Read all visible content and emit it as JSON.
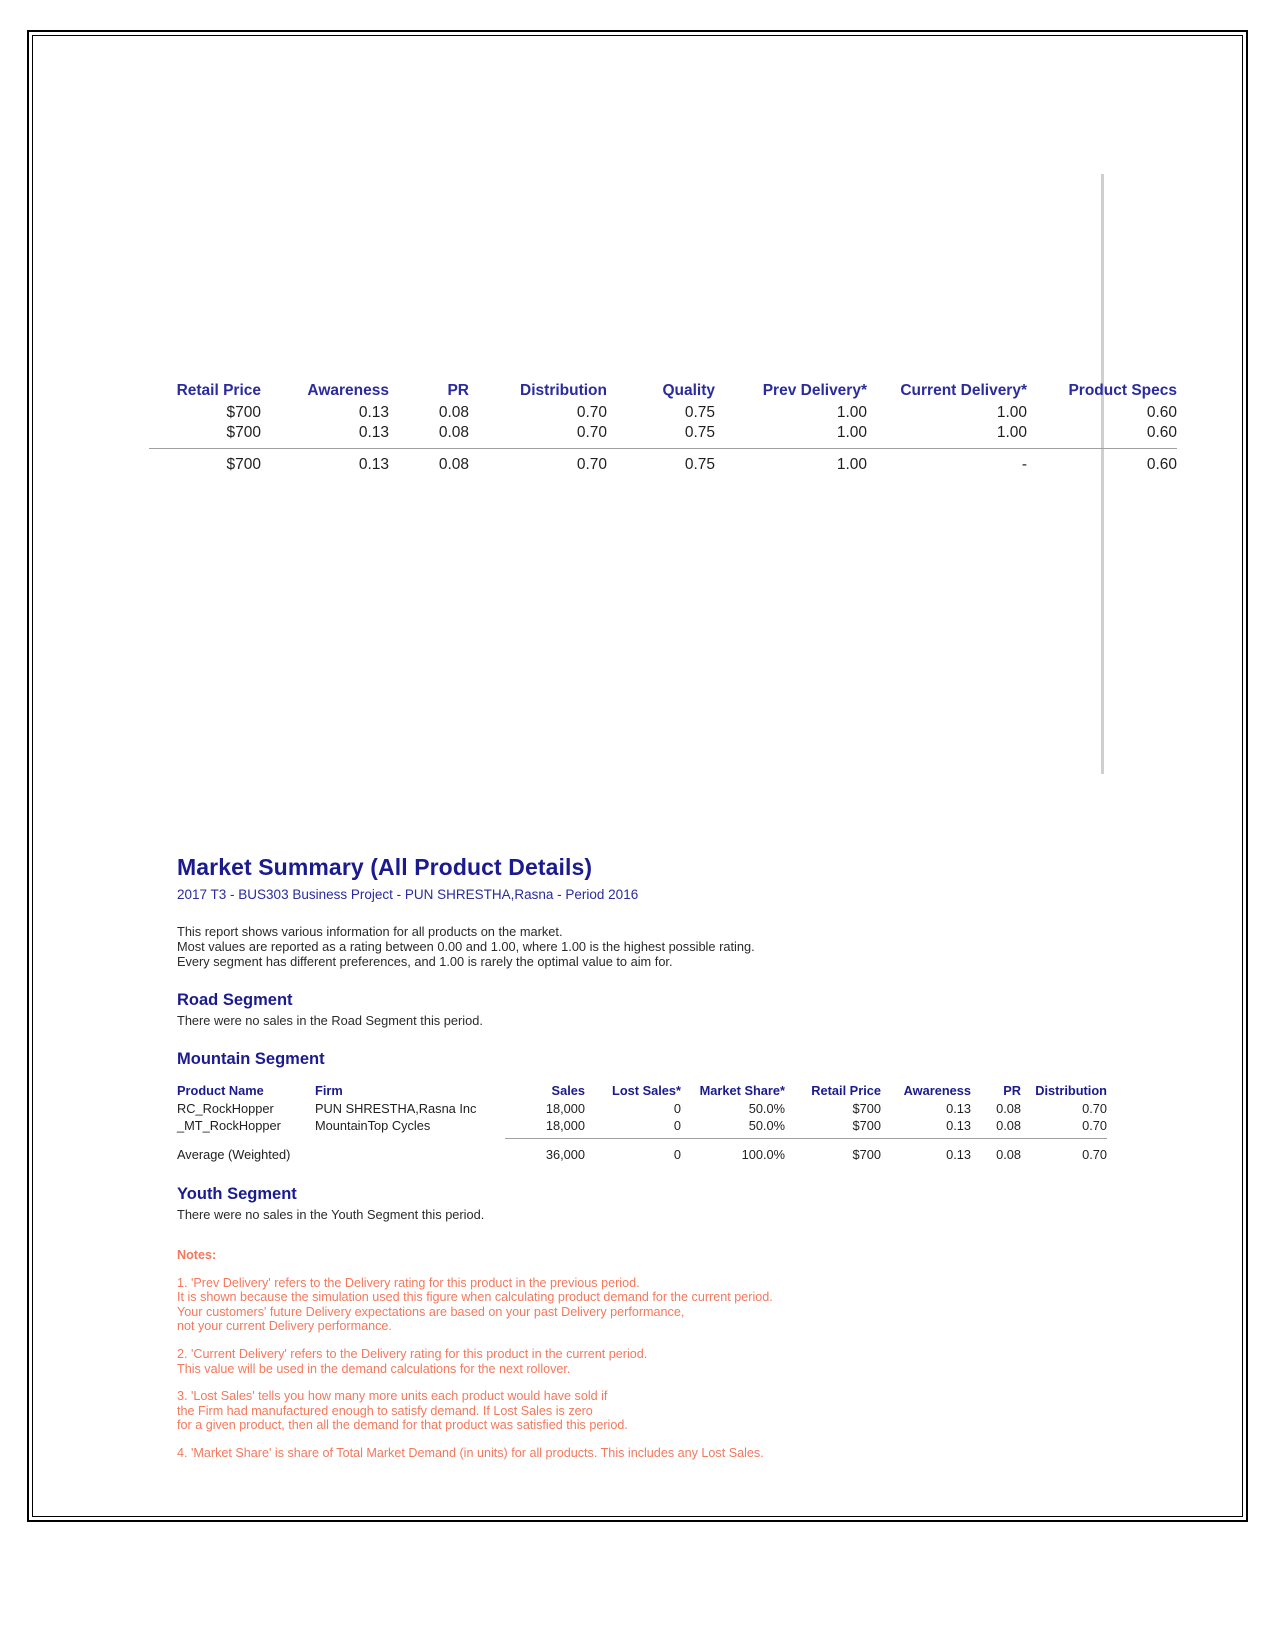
{
  "top_table": {
    "columns": [
      "Retail Price",
      "Awareness",
      "PR",
      "Distribution",
      "Quality",
      "Prev Delivery*",
      "Current Delivery*",
      "Product Specs"
    ],
    "rows": [
      [
        "$700",
        "0.13",
        "0.08",
        "0.70",
        "0.75",
        "1.00",
        "1.00",
        "0.60"
      ],
      [
        "$700",
        "0.13",
        "0.08",
        "0.70",
        "0.75",
        "1.00",
        "1.00",
        "0.60"
      ]
    ],
    "average": [
      "$700",
      "0.13",
      "0.08",
      "0.70",
      "0.75",
      "1.00",
      "-",
      "0.60"
    ]
  },
  "report": {
    "title": "Market Summary (All Product Details)",
    "subtitle": "2017 T3 - BUS303 Business Project - PUN SHRESTHA,Rasna - Period 2016",
    "intro": [
      "This report shows various information for all products on the market.",
      "Most values are reported as a rating between 0.00 and 1.00, where 1.00 is the highest possible rating.",
      "Every segment has different preferences, and 1.00 is rarely the optimal value to aim for."
    ],
    "road_segment": {
      "heading": "Road Segment",
      "note": "There were no sales in the Road Segment this period."
    },
    "mountain_segment": {
      "heading": "Mountain Segment",
      "columns": [
        "Product Name",
        "Firm",
        "Sales",
        "Lost Sales*",
        "Market Share*",
        "Retail Price",
        "Awareness",
        "PR",
        "Distribution"
      ],
      "rows": [
        {
          "product_name": "RC_RockHopper",
          "firm": "PUN SHRESTHA,Rasna Inc",
          "sales": "18,000",
          "lost_sales": "0",
          "market_share": "50.0%",
          "retail_price": "$700",
          "awareness": "0.13",
          "pr": "0.08",
          "distribution": "0.70"
        },
        {
          "product_name": "_MT_RockHopper",
          "firm": "MountainTop Cycles",
          "sales": "18,000",
          "lost_sales": "0",
          "market_share": "50.0%",
          "retail_price": "$700",
          "awareness": "0.13",
          "pr": "0.08",
          "distribution": "0.70"
        }
      ],
      "average": {
        "label": "Average (Weighted)",
        "firm": "",
        "sales": "36,000",
        "lost_sales": "0",
        "market_share": "100.0%",
        "retail_price": "$700",
        "awareness": "0.13",
        "pr": "0.08",
        "distribution": "0.70"
      }
    },
    "youth_segment": {
      "heading": "Youth Segment",
      "note": "There were no sales in the Youth Segment this period."
    },
    "notes": {
      "heading": "Notes:",
      "note1": [
        "1. 'Prev Delivery' refers to the Delivery rating for this product in the previous period.",
        "It is shown because the simulation used this figure when calculating product demand for the current period.",
        "Your customers' future Delivery expectations are based on your past Delivery performance,",
        "not your current Delivery performance."
      ],
      "note2": [
        "2. 'Current Delivery' refers to the Delivery rating for this product in the current period.",
        "This value will be used in the demand calculations for the next rollover."
      ],
      "note3": [
        "3. 'Lost Sales' tells you how many more units each product would have sold if",
        "the Firm had manufactured enough to satisfy demand. If Lost Sales is zero",
        "for a given product, then all the demand for that product was satisfied this period."
      ],
      "note4": [
        "4. 'Market Share' is share of Total Market Demand (in units) for all products. This includes any Lost Sales."
      ]
    }
  }
}
